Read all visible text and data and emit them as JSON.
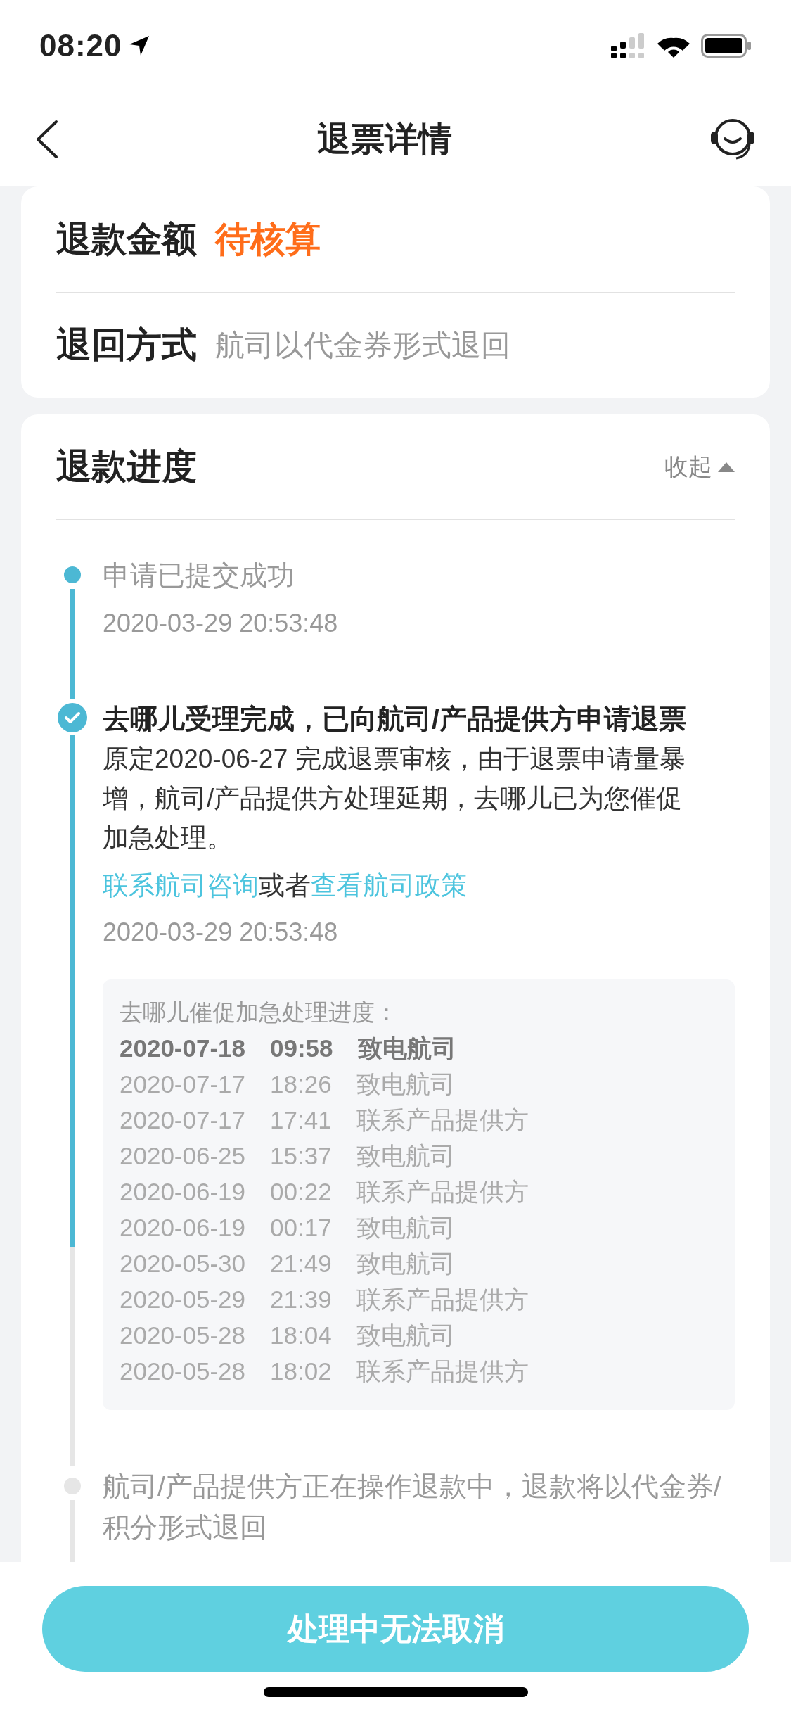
{
  "status_bar": {
    "time": "08:20"
  },
  "nav": {
    "title": "退票详情"
  },
  "refund_card": {
    "rows": [
      {
        "label": "退款金额",
        "value": "待核算",
        "kind": "highlight"
      },
      {
        "label": "退回方式",
        "value": "航司以代金券形式退回",
        "kind": "plain"
      }
    ]
  },
  "progress": {
    "title": "退款进度",
    "toggle": "收起",
    "expanded": true,
    "steps": [
      {
        "done": true,
        "active": false,
        "title": "申请已提交成功",
        "time": "2020-03-29 20:53:48"
      },
      {
        "done": true,
        "active": true,
        "title": "去哪儿受理完成，已向航司/产品提供方申请退票",
        "description": "原定2020-06-27 完成退票审核，由于退票申请量暴增，航司/产品提供方处理延期，去哪儿已为您催促加急处理。",
        "links": [
          {
            "kind": "link",
            "text": "联系航司咨询"
          },
          {
            "kind": "text",
            "text": "或者"
          },
          {
            "kind": "link",
            "text": "查看航司政策"
          }
        ],
        "time": "2020-03-29 20:53:48",
        "urge_log": {
          "heading": "去哪儿催促加急处理进度：",
          "entries": [
            {
              "date": "2020-07-18",
              "time": "09:58",
              "action": "致电航司",
              "latest": true
            },
            {
              "date": "2020-07-17",
              "time": "18:26",
              "action": "致电航司",
              "latest": false
            },
            {
              "date": "2020-07-17",
              "time": "17:41",
              "action": "联系产品提供方",
              "latest": false
            },
            {
              "date": "2020-06-25",
              "time": "15:37",
              "action": "致电航司",
              "latest": false
            },
            {
              "date": "2020-06-19",
              "time": "00:22",
              "action": "联系产品提供方",
              "latest": false
            },
            {
              "date": "2020-06-19",
              "time": "00:17",
              "action": "致电航司",
              "latest": false
            },
            {
              "date": "2020-05-30",
              "time": "21:49",
              "action": "致电航司",
              "latest": false
            },
            {
              "date": "2020-05-29",
              "time": "21:39",
              "action": "联系产品提供方",
              "latest": false
            },
            {
              "date": "2020-05-28",
              "time": "18:04",
              "action": "致电航司",
              "latest": false
            },
            {
              "date": "2020-05-28",
              "time": "18:02",
              "action": "联系产品提供方",
              "latest": false
            }
          ]
        }
      },
      {
        "done": false,
        "active": false,
        "title": "航司/产品提供方正在操作退款中，退款将以代金券/积分形式退回"
      }
    ]
  },
  "footer_button": {
    "label": "处理中无法取消",
    "disabled": true
  }
}
